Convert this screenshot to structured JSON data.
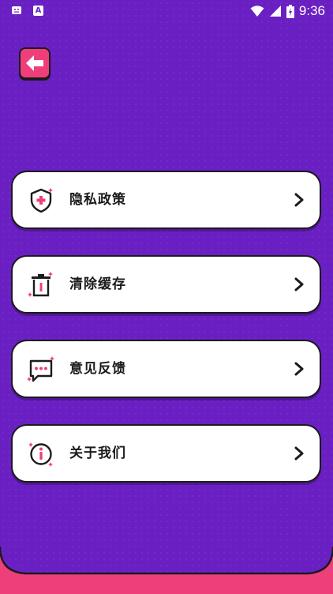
{
  "status_bar": {
    "time": "9:36",
    "icons": [
      "notification-icon",
      "a-badge-icon",
      "wifi-icon",
      "signal-icon",
      "battery-icon"
    ],
    "a_badge": "A"
  },
  "header": {
    "back_icon": "arrow-left-icon"
  },
  "menu": [
    {
      "id": "privacy",
      "label": "隐私政策",
      "icon": "shield-icon"
    },
    {
      "id": "cache",
      "label": "清除缓存",
      "icon": "trash-icon"
    },
    {
      "id": "feedback",
      "label": "意见反馈",
      "icon": "chat-bubble-icon"
    },
    {
      "id": "about",
      "label": "关于我们",
      "icon": "info-icon"
    }
  ],
  "colors": {
    "background": "#6a1fc2",
    "accent": "#ef3f7a",
    "card": "#ffffff",
    "outline": "#1b1b1b"
  }
}
